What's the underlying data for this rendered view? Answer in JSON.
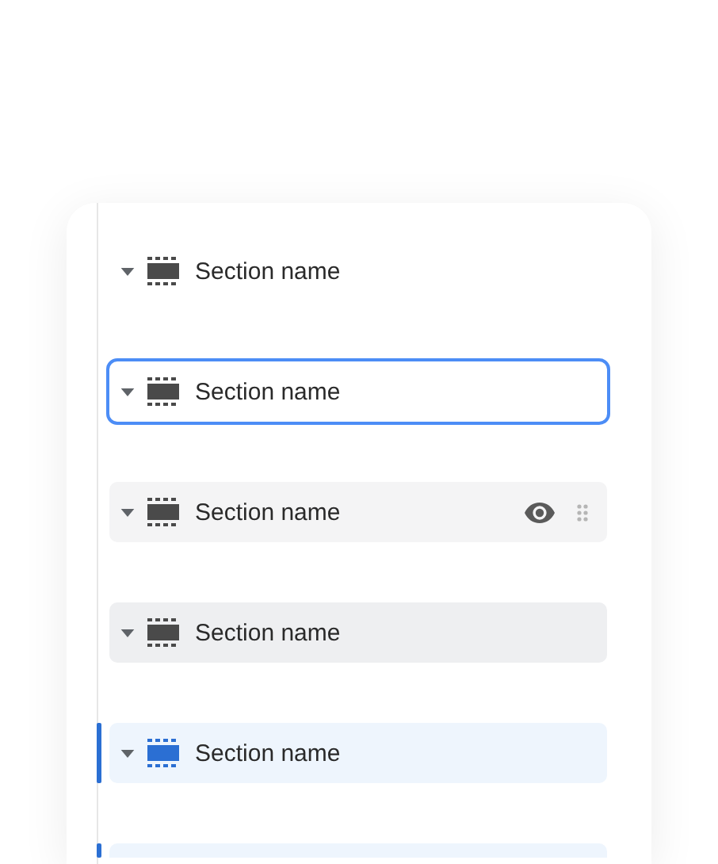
{
  "sections": [
    {
      "label": "Section name",
      "kind": "default"
    },
    {
      "label": "Section name",
      "kind": "focused"
    },
    {
      "label": "Section name",
      "kind": "hover"
    },
    {
      "label": "Section name",
      "kind": "pressed"
    },
    {
      "label": "Section name",
      "kind": "selected"
    },
    {
      "kind": "selected"
    }
  ]
}
